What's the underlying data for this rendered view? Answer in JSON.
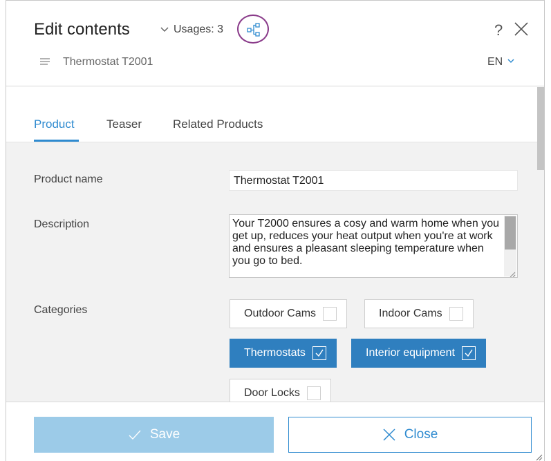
{
  "header": {
    "title": "Edit contents",
    "usages_label": "Usages: 3",
    "help": "?",
    "document_name": "Thermostat T2001",
    "language": "EN"
  },
  "tabs": [
    {
      "label": "Product",
      "active": true
    },
    {
      "label": "Teaser",
      "active": false
    },
    {
      "label": "Related Products",
      "active": false
    }
  ],
  "form": {
    "product_name_label": "Product name",
    "product_name_value": "Thermostat T2001",
    "description_label": "Description",
    "description_value": "Your T2000 ensures a cosy and warm home when you get up, reduces your heat output when you're at work and ensures a pleasant sleeping temperature when you go to bed.",
    "categories_label": "Categories",
    "categories": [
      {
        "label": "Outdoor Cams",
        "checked": false
      },
      {
        "label": "Indoor Cams",
        "checked": false
      },
      {
        "label": "Thermostats",
        "checked": true
      },
      {
        "label": "Interior equipment",
        "checked": true
      },
      {
        "label": "Door Locks",
        "checked": false
      }
    ]
  },
  "footer": {
    "save_label": "Save",
    "close_label": "Close"
  },
  "colors": {
    "accent": "#2f8bd0",
    "chip_selected": "#2f7fbf",
    "save_disabled": "#9ccbe8",
    "body_background": "#f2f2f2",
    "highlight_circle": "#8a3b8a"
  },
  "icons": [
    "chevron-down-icon",
    "usages-tree-icon",
    "close-icon",
    "document-lines-icon",
    "checkmark-icon",
    "resize-grip-icon"
  ]
}
